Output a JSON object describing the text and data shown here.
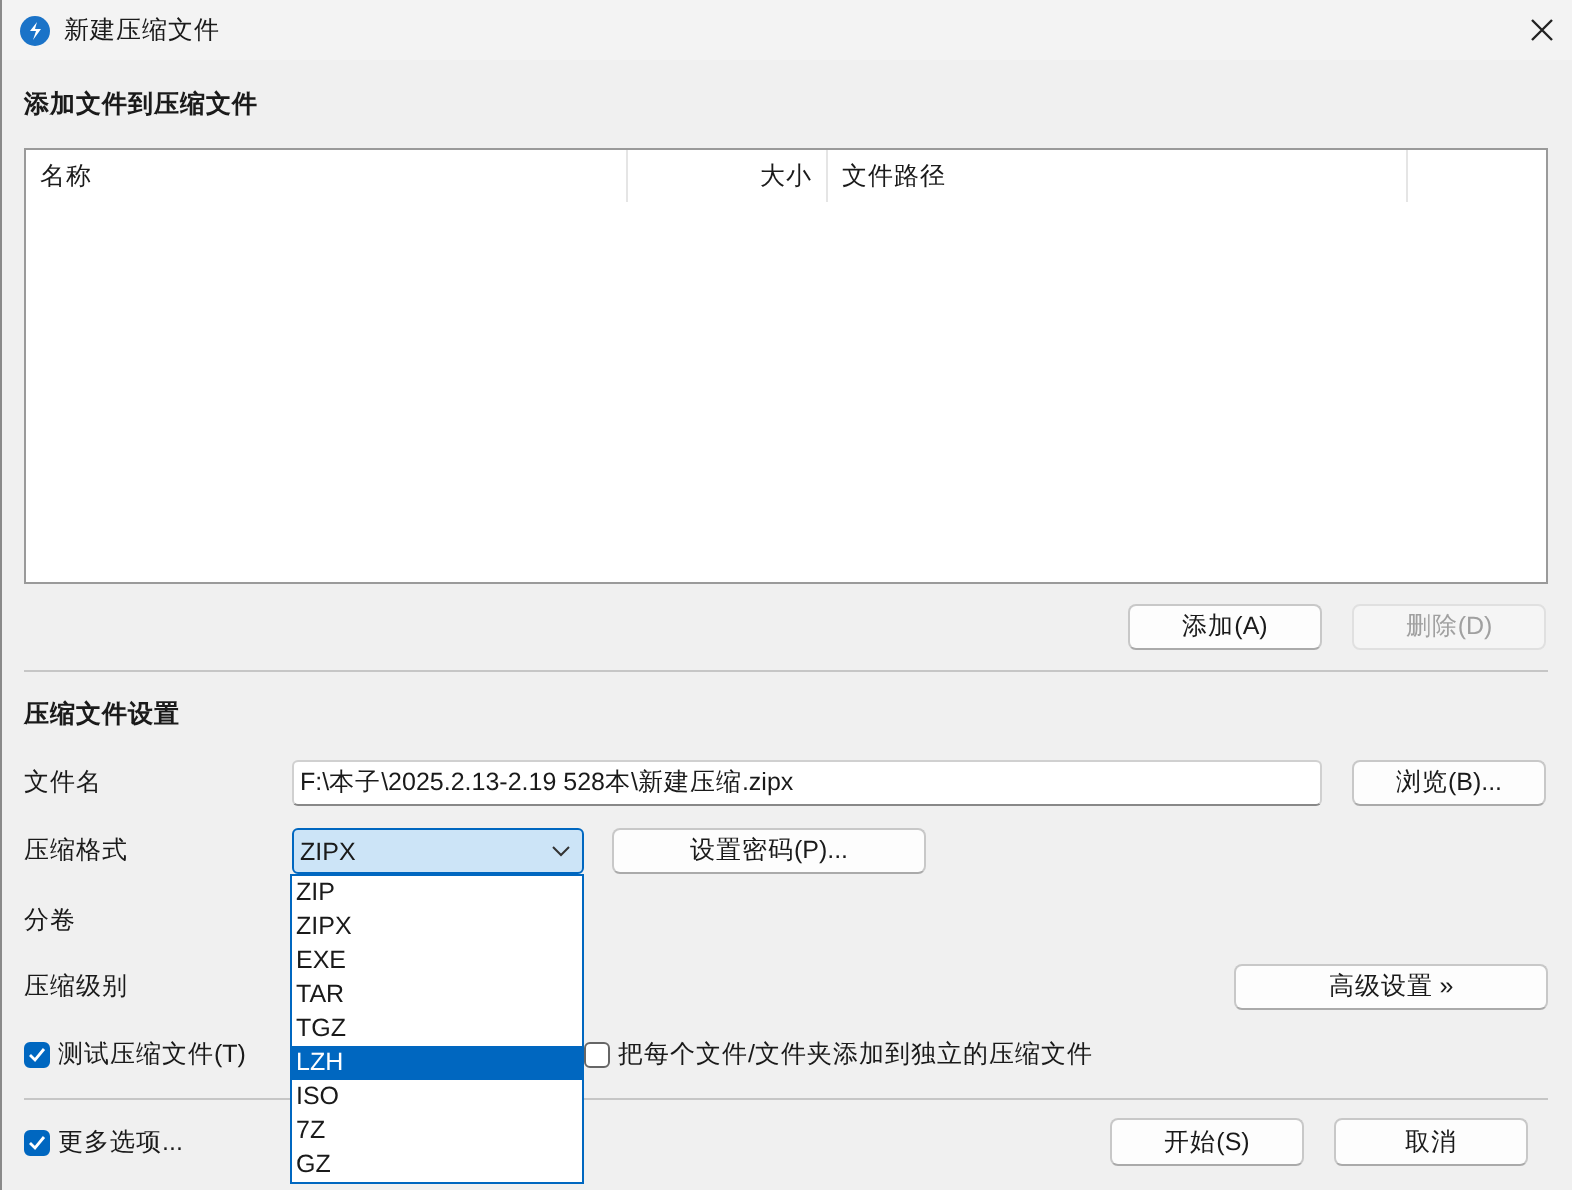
{
  "window": {
    "title": "新建压缩文件"
  },
  "files_section": {
    "heading": "添加文件到压缩文件",
    "columns": [
      "名称",
      "大小",
      "文件路径"
    ],
    "buttons": [
      {
        "label": "添加(A)",
        "disabled": false
      },
      {
        "label": "删除(D)",
        "disabled": true
      }
    ]
  },
  "settings": {
    "heading": "压缩文件设置",
    "filename": {
      "label": "文件名",
      "value": "F:\\本子\\2025.2.13-2.19 528本\\新建压缩.zipx",
      "browse_button": "浏览(B)..."
    },
    "format": {
      "label": "压缩格式",
      "value": "ZIPX",
      "expanded": true,
      "password_button": "设置密码(P)...",
      "options": [
        {
          "label": "ZIP",
          "highlighted": false
        },
        {
          "label": "ZIPX",
          "highlighted": false
        },
        {
          "label": "EXE",
          "highlighted": false
        },
        {
          "label": "TAR",
          "highlighted": false
        },
        {
          "label": "TGZ",
          "highlighted": false
        },
        {
          "label": "LZH",
          "highlighted": true
        },
        {
          "label": "ISO",
          "highlighted": false
        },
        {
          "label": "7Z",
          "highlighted": false
        },
        {
          "label": "GZ",
          "highlighted": false
        }
      ]
    },
    "split": {
      "label": "分卷"
    },
    "level": {
      "label": "压缩级别"
    },
    "advanced_button": "高级设置 »",
    "options": [
      {
        "label": "测试压缩文件(T)",
        "checked": true
      },
      {
        "label": "把每个文件/文件夹添加到独立的压缩文件",
        "checked": false
      }
    ]
  },
  "footer": {
    "more_options": {
      "label": "更多选项...",
      "checked": true
    },
    "buttons": [
      "开始(S)",
      "取消"
    ]
  }
}
